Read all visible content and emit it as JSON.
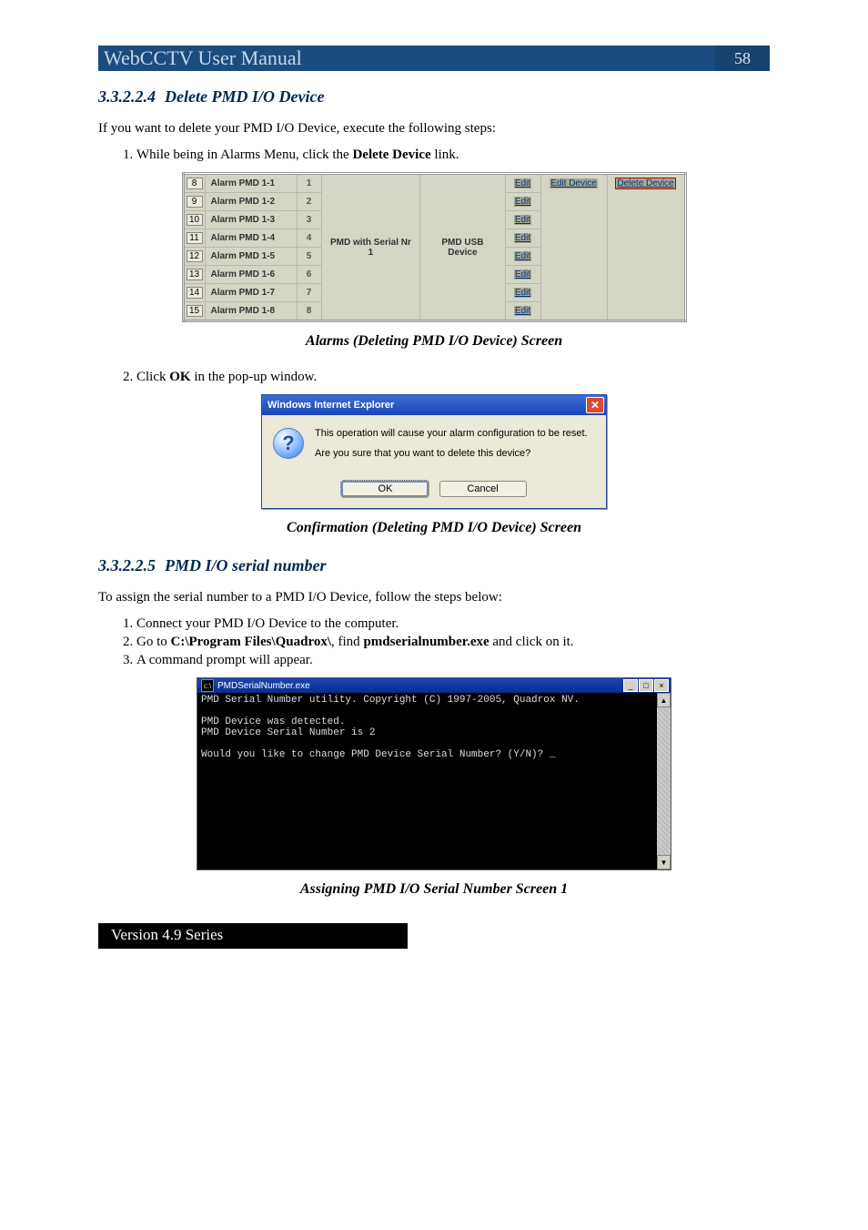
{
  "header": {
    "title": "WebCCTV User Manual",
    "page_number": "58"
  },
  "sections": {
    "s1": {
      "num": "3.3.2.2.4",
      "title": "Delete PMD I/O Device"
    },
    "s2": {
      "num": "3.3.2.2.5",
      "title": "PMD I/O serial number"
    }
  },
  "text": {
    "p1": "If you want to delete your PMD I/O Device, execute the following steps:",
    "step1_prefix": "While being in Alarms Menu, click the ",
    "step1_bold": "Delete Device",
    "step1_suffix": " link.",
    "caption1": "Alarms (Deleting PMD I/O Device) Screen",
    "step2_prefix": "Click ",
    "step2_bold": "OK",
    "step2_suffix": " in the pop-up window.",
    "caption2": "Confirmation (Deleting PMD I/O Device) Screen",
    "p2": "To assign the serial number to a PMD I/O Device, follow the steps below:",
    "s2_step1": "Connect your PMD I/O Device to the computer.",
    "s2_step2_prefix": "Go to ",
    "s2_step2_bold1": "C:\\Program Files\\Quadrox\\",
    "s2_step2_mid": ", find ",
    "s2_step2_bold2": "pmdserialnumber.exe",
    "s2_step2_suffix": " and click on it.",
    "s2_step3": "A command prompt will appear.",
    "caption3": "Assigning PMD I/O Serial Number Screen 1"
  },
  "alarm_table": {
    "device_col": "PMD with Serial Nr 1",
    "type_col": "PMD USB Device",
    "edit_label": "Edit",
    "edit_device_label": "Edit Device",
    "delete_device_label": "Delete Device",
    "rows": [
      {
        "idx": "8",
        "name": "Alarm PMD 1-1",
        "chan": "1"
      },
      {
        "idx": "9",
        "name": "Alarm PMD 1-2",
        "chan": "2"
      },
      {
        "idx": "10",
        "name": "Alarm PMD 1-3",
        "chan": "3"
      },
      {
        "idx": "11",
        "name": "Alarm PMD 1-4",
        "chan": "4"
      },
      {
        "idx": "12",
        "name": "Alarm PMD 1-5",
        "chan": "5"
      },
      {
        "idx": "13",
        "name": "Alarm PMD 1-6",
        "chan": "6"
      },
      {
        "idx": "14",
        "name": "Alarm PMD 1-7",
        "chan": "7"
      },
      {
        "idx": "15",
        "name": "Alarm PMD 1-8",
        "chan": "8"
      }
    ]
  },
  "dialog": {
    "title": "Windows Internet Explorer",
    "line1": "This operation will cause your alarm configuration to be reset.",
    "line2": "Are you sure that you want to delete this device?",
    "ok": "OK",
    "cancel": "Cancel"
  },
  "console": {
    "title": "PMDSerialNumber.exe",
    "lines": "PMD Serial Number utility. Copyright (C) 1997-2005, Quadrox NV.\n\nPMD Device was detected.\nPMD Device Serial Number is 2\n\nWould you like to change PMD Device Serial Number? (Y/N)? _"
  },
  "footer": {
    "version": "Version 4.9 Series"
  }
}
